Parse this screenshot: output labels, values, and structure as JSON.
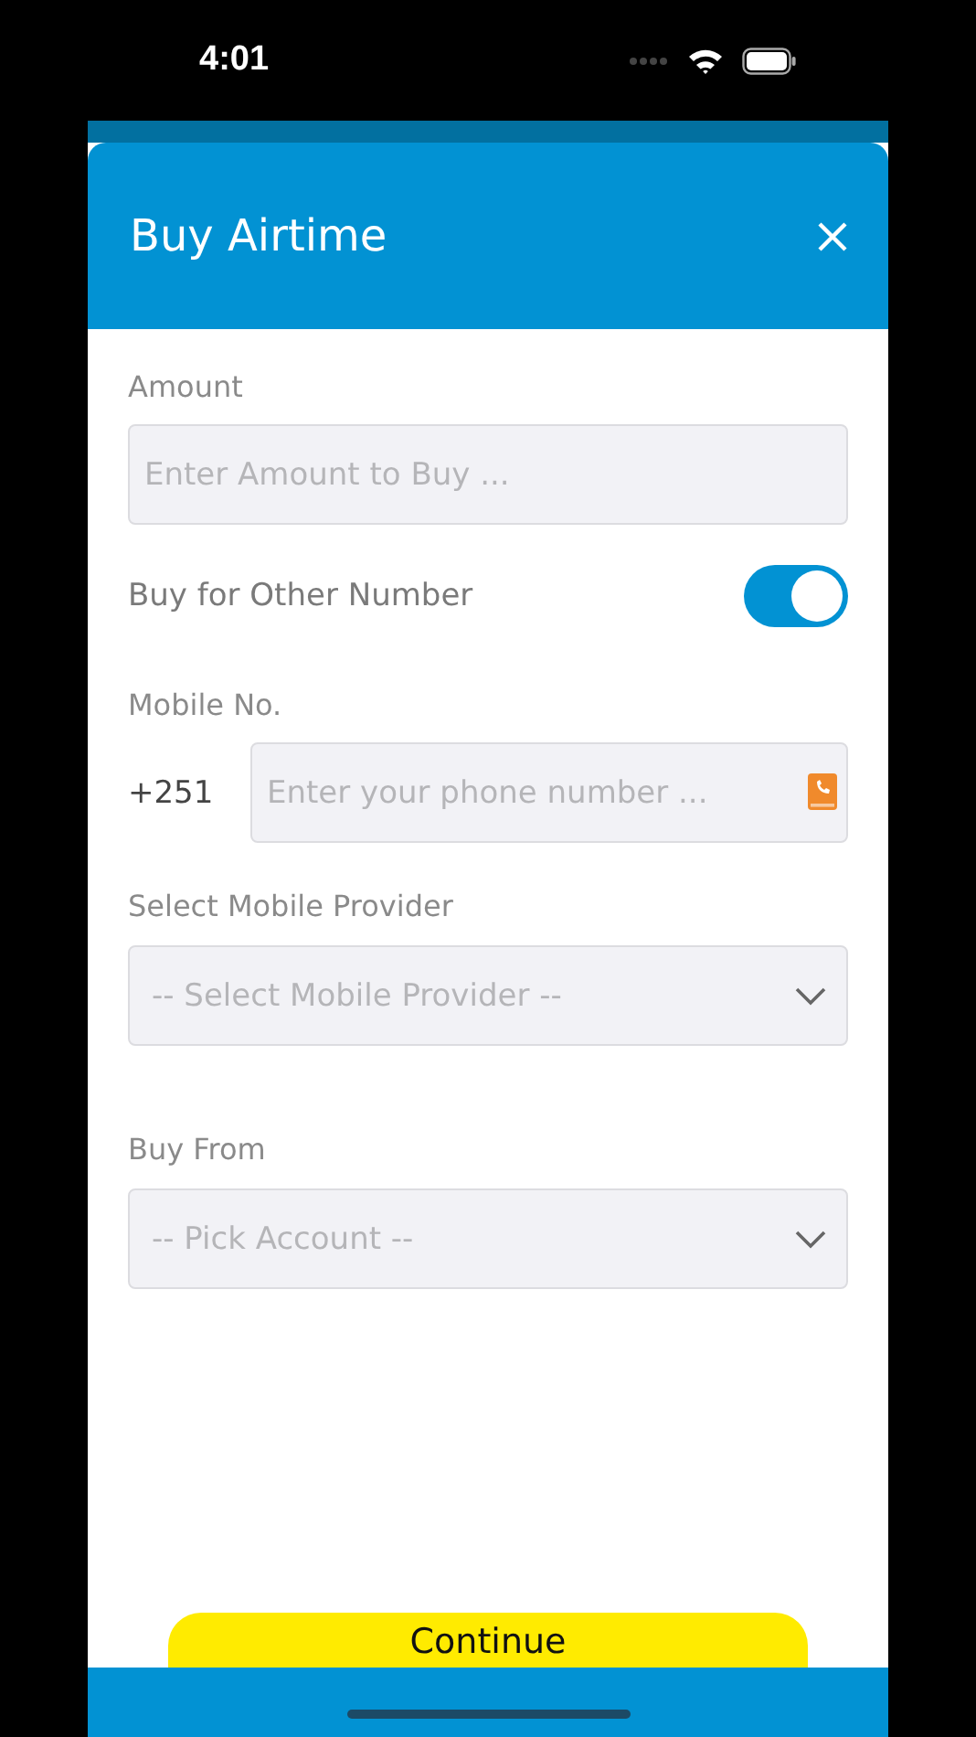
{
  "status_bar": {
    "time": "4:01"
  },
  "dialog": {
    "title": "Buy Airtime"
  },
  "amount": {
    "label": "Amount",
    "placeholder": "Enter Amount to Buy ..."
  },
  "other_number": {
    "label": "Buy for Other Number",
    "on": true
  },
  "mobile": {
    "label": "Mobile No.",
    "prefix": "+251",
    "placeholder": "Enter your phone number ..."
  },
  "provider": {
    "label": "Select Mobile Provider",
    "placeholder": "-- Select Mobile Provider --"
  },
  "buy_from": {
    "label": "Buy From",
    "placeholder": "-- Pick Account --"
  },
  "continue_button": {
    "label": "Continue"
  }
}
